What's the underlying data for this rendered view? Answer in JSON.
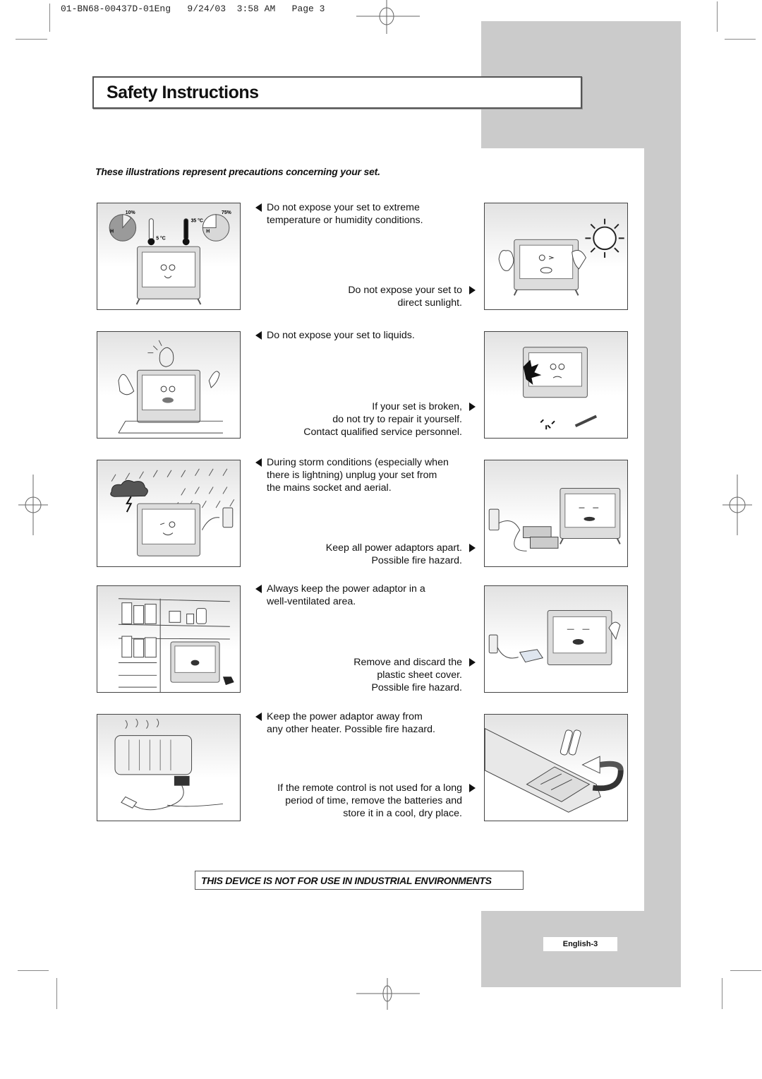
{
  "print_slug": "01-BN68-00437D-01Eng   9/24/03  3:58 AM   Page 3",
  "header": {
    "title": "Safety Instructions",
    "subtitle": "These illustrations represent precautions concerning your set."
  },
  "colors": {
    "tab_gray": "#cbcbcb",
    "text": "#111111",
    "border": "#555555"
  },
  "illustration_labels": {
    "humidity_low": "10%",
    "humidity_high": "75%",
    "humidity_mark": "H",
    "temp_low": "5 °C",
    "temp_high": "35 °C"
  },
  "precautions": [
    {
      "side": "left",
      "arrow": "left-arrow-icon",
      "lines": [
        "Do not expose your set to extreme",
        "temperature or humidity conditions."
      ]
    },
    {
      "side": "right",
      "arrow": "right-arrow-icon",
      "lines": [
        "Do not expose your set to",
        "direct sunlight."
      ]
    },
    {
      "side": "left",
      "arrow": "left-arrow-icon",
      "lines": [
        "Do not expose your set to liquids."
      ]
    },
    {
      "side": "right",
      "arrow": "right-arrow-icon",
      "lines": [
        "If your set is broken,",
        "do not try to repair it yourself.",
        "Contact qualified service personnel."
      ]
    },
    {
      "side": "left",
      "arrow": "left-arrow-icon",
      "lines": [
        "During storm conditions (especially when",
        "there is lightning) unplug your set from",
        "the mains socket and aerial."
      ]
    },
    {
      "side": "right",
      "arrow": "right-arrow-icon",
      "lines": [
        "Keep all power adaptors apart.",
        "Possible fire hazard."
      ]
    },
    {
      "side": "left",
      "arrow": "left-arrow-icon",
      "lines": [
        "Always keep the power adaptor in a",
        "well-ventilated area."
      ]
    },
    {
      "side": "right",
      "arrow": "right-arrow-icon",
      "lines": [
        "Remove and discard the",
        "plastic sheet cover.",
        "Possible fire hazard."
      ]
    },
    {
      "side": "left",
      "arrow": "left-arrow-icon",
      "lines": [
        "Keep the power adaptor away from",
        "any other heater. Possible fire hazard."
      ]
    },
    {
      "side": "right",
      "arrow": "right-arrow-icon",
      "lines": [
        "If the remote control is not used for a long",
        "period of time, remove the batteries and",
        "store it in a cool, dry place."
      ]
    }
  ],
  "warning": "THIS DEVICE IS NOT FOR USE IN INDUSTRIAL ENVIRONMENTS",
  "page_label": "English-3"
}
